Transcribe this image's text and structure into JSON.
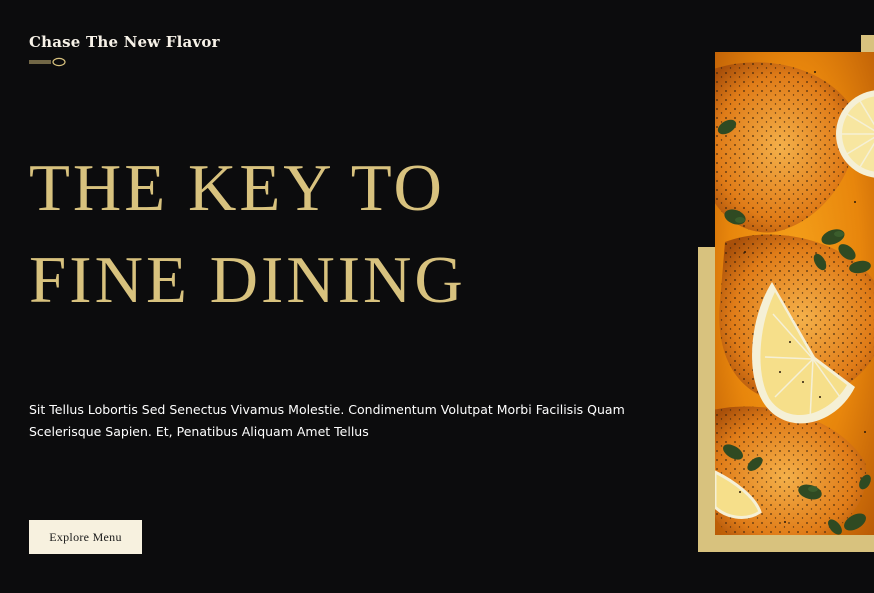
{
  "hero": {
    "tagline": "Chase The New Flavor",
    "headline_line1": "THE KEY TO",
    "headline_line2": "FINE DINING",
    "description": "Sit Tellus Lobortis Sed Senectus Vivamus Molestie. Condimentum Volutpat Morbi Facilisis Quam Scelerisque Sapien. Et, Penatibus Aliquam Amet Tellus",
    "cta_label": "Explore Menu"
  },
  "icons": {
    "divider": "spoon-icon"
  },
  "image": {
    "subject": "dish-photo"
  },
  "colors": {
    "background": "#0c0c0d",
    "accent_gold": "#d8c27e",
    "button_bg": "#f7f1df",
    "text_light": "#ffffff",
    "sauce_orange": "#e8920f",
    "lemon": "#f7e9a8",
    "herb_green": "#2f4a22"
  }
}
